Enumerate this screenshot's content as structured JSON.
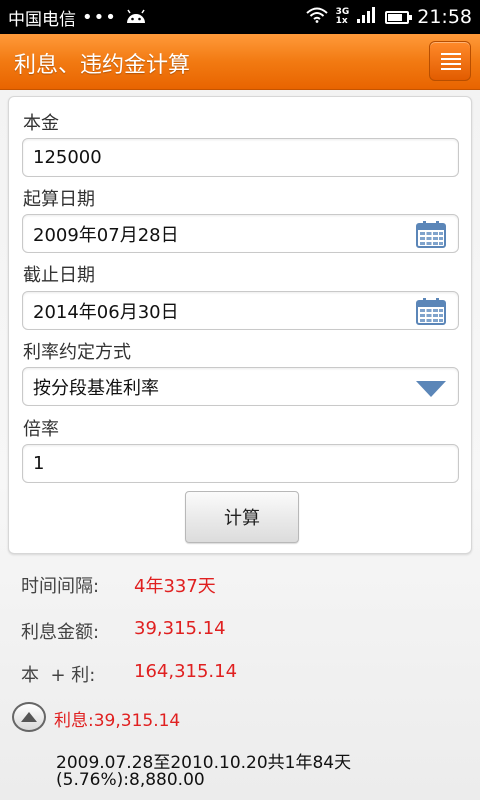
{
  "status_bar": {
    "carrier": "中国电信",
    "dots": "•••",
    "net_top": "3G",
    "net_bottom": "1x",
    "time": "21:58"
  },
  "header": {
    "title": "利息、违约金计算",
    "menu_icon": "list-menu-icon"
  },
  "form": {
    "principal_label": "本金",
    "principal_value": "125000",
    "start_label": "起算日期",
    "start_value": "2009年07月28日",
    "end_label": "截止日期",
    "end_value": "2014年06月30日",
    "rate_mode_label": "利率约定方式",
    "rate_mode_value": "按分段基准利率",
    "multiplier_label": "倍率",
    "multiplier_value": "1",
    "calc_label": "计算"
  },
  "results": {
    "interval_label": "时间间隔:",
    "interval_value": "4年337天",
    "interest_label": "利息金额:",
    "interest_value": "39,315.14",
    "total_label": "本  + 利:",
    "total_value": "164,315.14"
  },
  "detail": {
    "title": "利息:39,315.14",
    "line1": "2009.07.28至2010.10.20共1年84天",
    "line2": "(5.76%):8,880.00"
  },
  "colors": {
    "accent": "#f27a12",
    "value_red": "#e02020",
    "icon_blue": "#5b86b8"
  }
}
